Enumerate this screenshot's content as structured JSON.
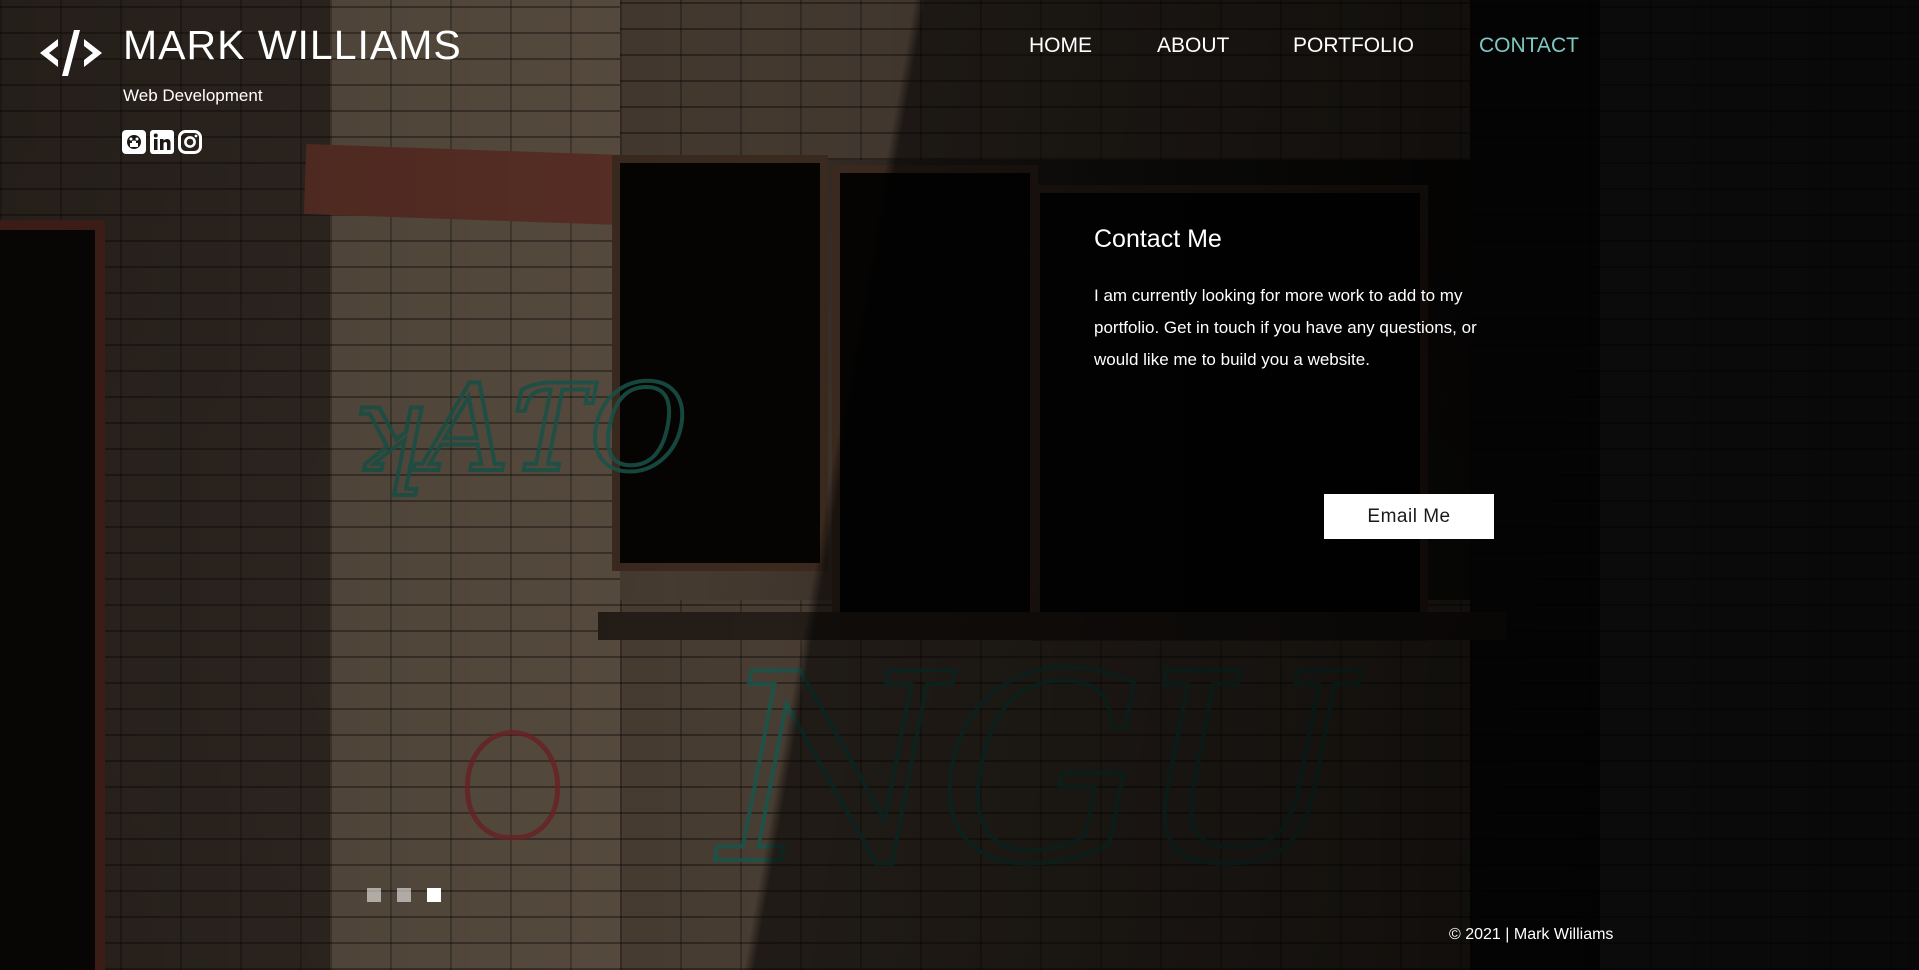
{
  "header": {
    "logo_icon": "code-brackets-icon",
    "title": "MARK WILLIAMS",
    "subtitle": "Web Development",
    "social": [
      {
        "icon": "github-icon"
      },
      {
        "icon": "linkedin-icon"
      },
      {
        "icon": "instagram-icon"
      }
    ]
  },
  "nav": {
    "items": [
      {
        "label": "HOME"
      },
      {
        "label": "ABOUT"
      },
      {
        "label": "PORTFOLIO"
      },
      {
        "label": "CONTACT",
        "active": true
      }
    ],
    "active_color": "#7ec8c2"
  },
  "contact": {
    "heading": "Contact Me",
    "text": "I am currently looking for more work to add to my portfolio. Get in touch if you have any questions, or would like me to build you a website.",
    "button_label": "Email Me"
  },
  "slider": {
    "slide_count": 3,
    "active_slide": 3
  },
  "footer": {
    "copyright": "© 2021 | Mark Williams"
  }
}
